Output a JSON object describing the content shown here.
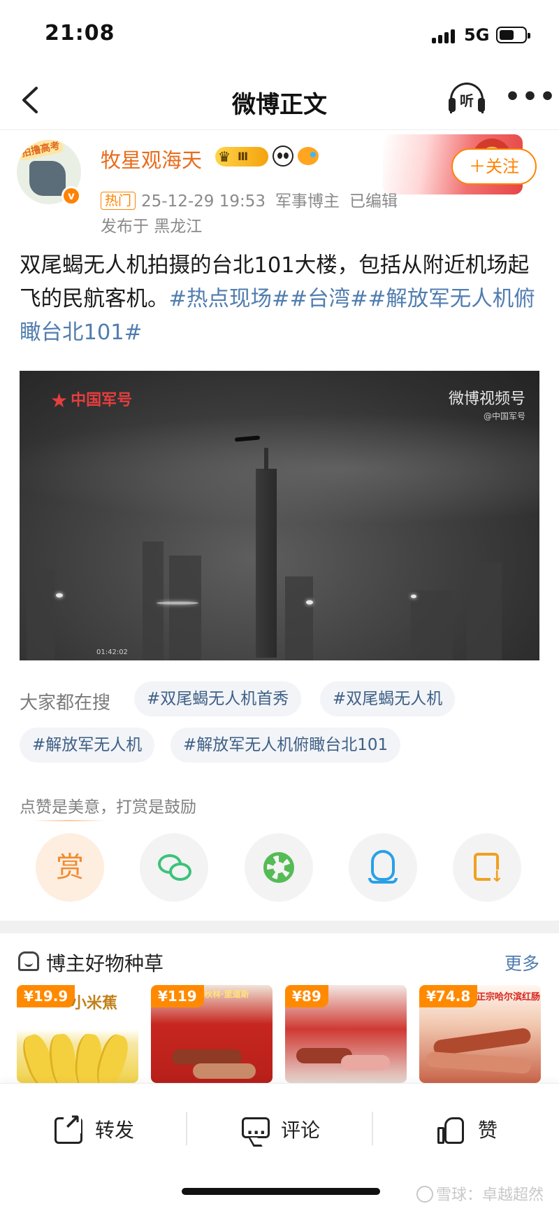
{
  "status_bar": {
    "time": "21:08",
    "network": "5G",
    "battery_level": 0.6
  },
  "nav": {
    "title": "微博正文",
    "listen_label": "听"
  },
  "author": {
    "name": "牧星观海天",
    "avatar_tag": "拍撸高考",
    "vip_level": "Ⅲ",
    "verified_mark": "v",
    "hot_badge": "热门",
    "post_time": "25-12-29 19:53",
    "role": "军事博主",
    "edited": "已编辑",
    "location": "发布于 黑龙江",
    "follow_label": "＋关注"
  },
  "post": {
    "text": "双尾蝎无人机拍摄的台北101大楼，包括从附近机场起飞的民航客机。",
    "topics": [
      "#热点现场#",
      "#台湾#",
      "#解放军无人机俯瞰台北101#"
    ]
  },
  "video": {
    "watermark_left": "中国军号",
    "watermark_right": "微博视频号",
    "watermark_right_sub": "@中国军号",
    "timecode": "01:42:02"
  },
  "trending": {
    "label": "大家都在搜",
    "chips": [
      "#双尾蝎无人机首秀",
      "#双尾蝎无人机",
      "#解放军无人机",
      "#解放军无人机俯瞰台北101"
    ]
  },
  "tip": {
    "text": "点赞是美意，打赏是鼓励",
    "reward_label": "赏"
  },
  "goods": {
    "title": "博主好物种草",
    "more": "更多",
    "products": [
      {
        "price": "¥19.9",
        "label": "小米蕉"
      },
      {
        "price": "¥119",
        "label": "秋林·里道斯"
      },
      {
        "price": "¥89",
        "label": ""
      },
      {
        "price": "¥74.8",
        "label": "正宗哈尔滨红肠"
      }
    ]
  },
  "bottom_bar": {
    "forward": "转发",
    "comment": "评论",
    "like": "赞"
  },
  "watermark": "雪球：卓越超然"
}
